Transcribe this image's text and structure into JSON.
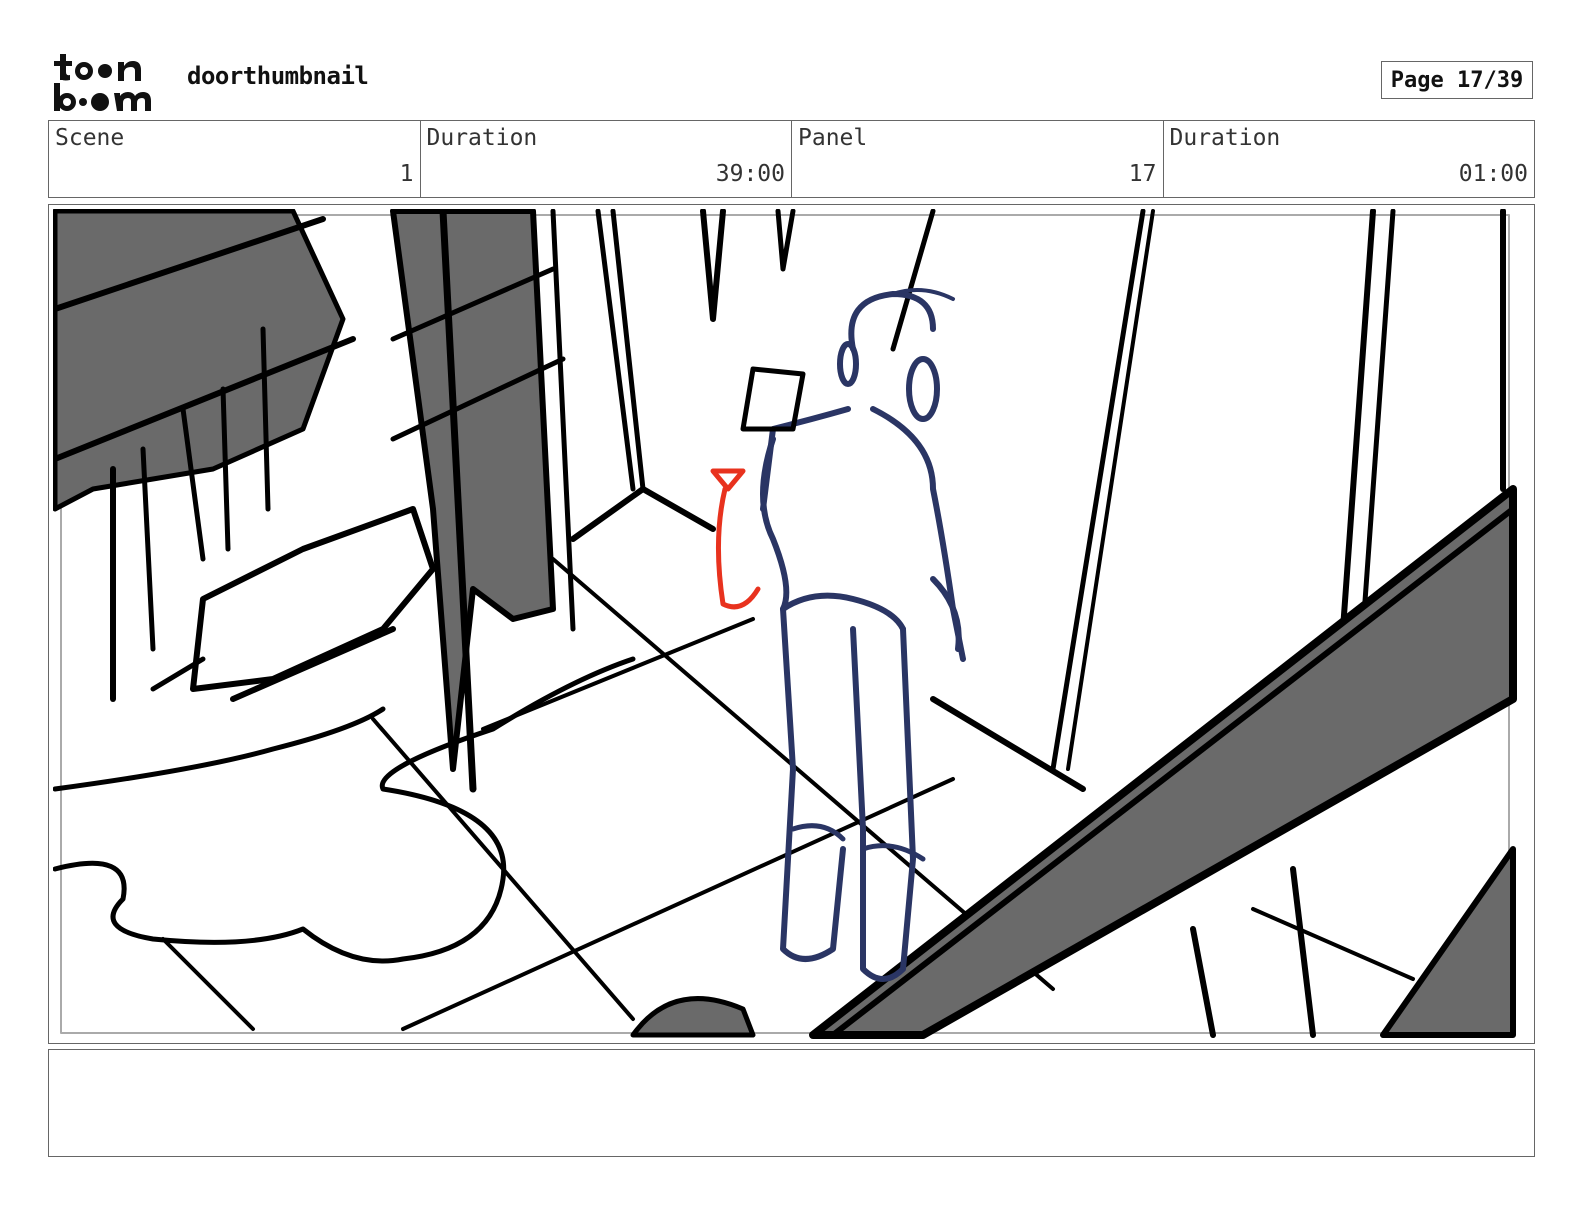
{
  "header": {
    "logo_text_top": "toon",
    "logo_text_bottom": "boom",
    "title": "doorthumbnail",
    "page": "Page 17/39"
  },
  "info": [
    {
      "label": "Scene",
      "value": "1"
    },
    {
      "label": "Duration",
      "value": "39:00"
    },
    {
      "label": "Panel",
      "value": "17"
    },
    {
      "label": "Duration",
      "value": "01:00"
    }
  ],
  "panel": {
    "sketch_colors": {
      "line": "#000000",
      "shade": "#6a6a6a",
      "character": "#2a3564",
      "accent": "#e8321e"
    }
  },
  "notes": {
    "text": ""
  }
}
